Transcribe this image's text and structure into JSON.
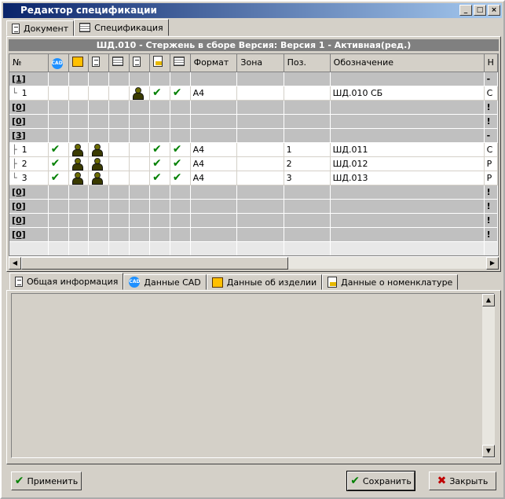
{
  "window": {
    "title": "Редактор спецификации"
  },
  "tabs_top": [
    {
      "label": "Документ",
      "icon": "document-icon"
    },
    {
      "label": "Спецификация",
      "icon": "spec-icon"
    }
  ],
  "spec_header": "ШД.010 - Стержень в сборе Версия: Версия 1 -  Активная(ред.)",
  "columns": {
    "num": "№",
    "format": "Формат",
    "zone": "Зона",
    "pos": "Поз.",
    "designation": "Обозначение",
    "name_partial": "Н"
  },
  "rows": [
    {
      "type": "group",
      "label": "[1]",
      "right": "-"
    },
    {
      "type": "item",
      "num": "1",
      "tree": "└",
      "c1": "",
      "c2": "",
      "c3": "",
      "c4": "",
      "c5": "man",
      "c6": "check",
      "c7": "check",
      "format": "A4",
      "zone": "",
      "pos": "",
      "designation": "ШД.010 СБ",
      "right": "С"
    },
    {
      "type": "group",
      "label": "[0]",
      "right": "!"
    },
    {
      "type": "group",
      "label": "[0]",
      "right": "!"
    },
    {
      "type": "group",
      "label": "[3]",
      "right": "-"
    },
    {
      "type": "item",
      "num": "1",
      "tree": "├",
      "c1": "check",
      "c2": "man",
      "c3": "man",
      "c4": "",
      "c5": "",
      "c6": "check",
      "c7": "check",
      "format": "A4",
      "zone": "",
      "pos": "1",
      "designation": "ШД.011",
      "right": "С"
    },
    {
      "type": "item",
      "num": "2",
      "tree": "├",
      "c1": "check",
      "c2": "man",
      "c3": "man",
      "c4": "",
      "c5": "",
      "c6": "check",
      "c7": "check",
      "format": "A4",
      "zone": "",
      "pos": "2",
      "designation": "ШД.012",
      "right": "Р"
    },
    {
      "type": "item",
      "num": "3",
      "tree": "└",
      "c1": "check",
      "c2": "man",
      "c3": "man",
      "c4": "",
      "c5": "",
      "c6": "check",
      "c7": "check",
      "format": "A4",
      "zone": "",
      "pos": "3",
      "designation": "ШД.013",
      "right": "Р"
    },
    {
      "type": "group",
      "label": "[0]",
      "right": "!"
    },
    {
      "type": "group",
      "label": "[0]",
      "right": "!"
    },
    {
      "type": "group",
      "label": "[0]",
      "right": "!"
    },
    {
      "type": "group",
      "label": "[0]",
      "right": "!"
    }
  ],
  "tabs_bottom": [
    {
      "label": "Общая информация",
      "icon": "document-icon"
    },
    {
      "label": "Данные  CAD",
      "icon": "cad-icon"
    },
    {
      "label": "Данные об изделии",
      "icon": "box-icon"
    },
    {
      "label": "Данные о номенклатуре",
      "icon": "nomenclature-icon"
    }
  ],
  "buttons": {
    "apply": "Применить",
    "save": "Сохранить",
    "close": "Закрыть"
  },
  "titlebar_buttons": {
    "min": "_",
    "max": "□",
    "close": "×"
  }
}
